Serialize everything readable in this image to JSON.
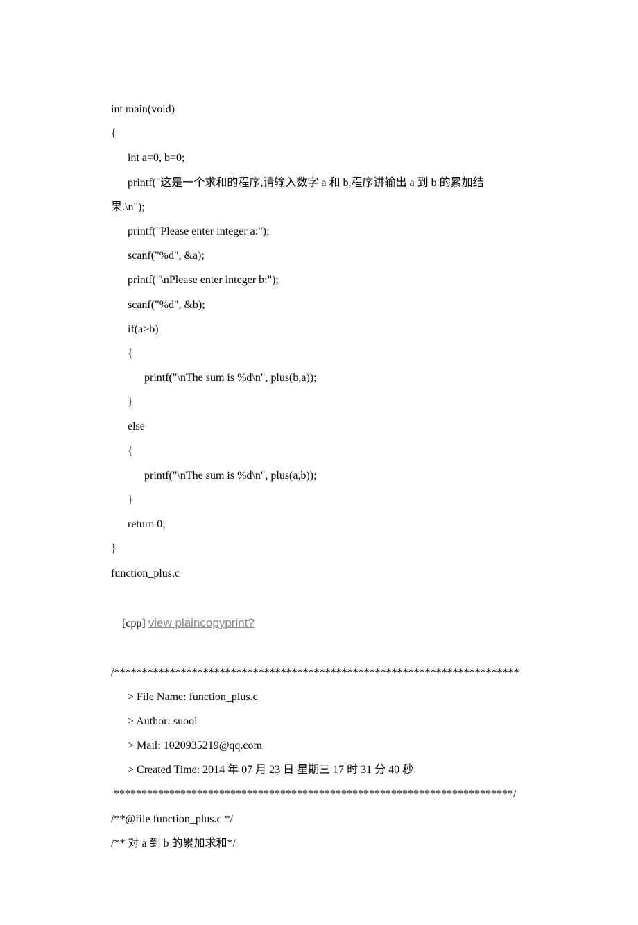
{
  "lines": [
    {
      "text": "int main(void)",
      "indent": 0
    },
    {
      "text": "{",
      "indent": 0
    },
    {
      "text": "int a=0, b=0;",
      "indent": 1
    },
    {
      "text": "printf(\"这是一个求和的程序,请输入数字 a 和 b,程序讲输出 a 到 b 的累加结果.\\n\");",
      "indent": 1,
      "wrap": true
    },
    {
      "text": "printf(\"Please enter integer a:\");",
      "indent": 1
    },
    {
      "text": "scanf(\"%d\", &a);",
      "indent": 1
    },
    {
      "text": "printf(\"\\nPlease enter integer b:\");",
      "indent": 1
    },
    {
      "text": "scanf(\"%d\", &b);",
      "indent": 1
    },
    {
      "text": "if(a>b)",
      "indent": 1
    },
    {
      "text": "{",
      "indent": 1
    },
    {
      "text": "printf(\"\\nThe sum is %d\\n\", plus(b,a));",
      "indent": 2
    },
    {
      "text": "}",
      "indent": 1
    },
    {
      "text": "else",
      "indent": 1
    },
    {
      "text": "{",
      "indent": 1
    },
    {
      "text": "printf(\"\\nThe sum is %d\\n\", plus(a,b));",
      "indent": 2
    },
    {
      "text": "}",
      "indent": 1
    },
    {
      "text": "return 0;",
      "indent": 1
    },
    {
      "text": "}",
      "indent": 0
    }
  ],
  "filename_label": "function_plus.c",
  "cpp_label": "[cpp] ",
  "link_text": "view plaincopyprint?",
  "comment_block": {
    "open_stars": "/*************************************************************************",
    "file_name": "> File Name: function_plus.c",
    "author": "> Author: suool",
    "mail": "> Mail: 1020935219@qq.com",
    "created": "> Created Time: 2014 年 07 月 23 日 星期三 17 时 31 分 40 秒",
    "close_stars": " ************************************************************************/"
  },
  "trailing_comments": [
    "/**@file function_plus.c */",
    "/** 对 a 到 b 的累加求和*/"
  ]
}
